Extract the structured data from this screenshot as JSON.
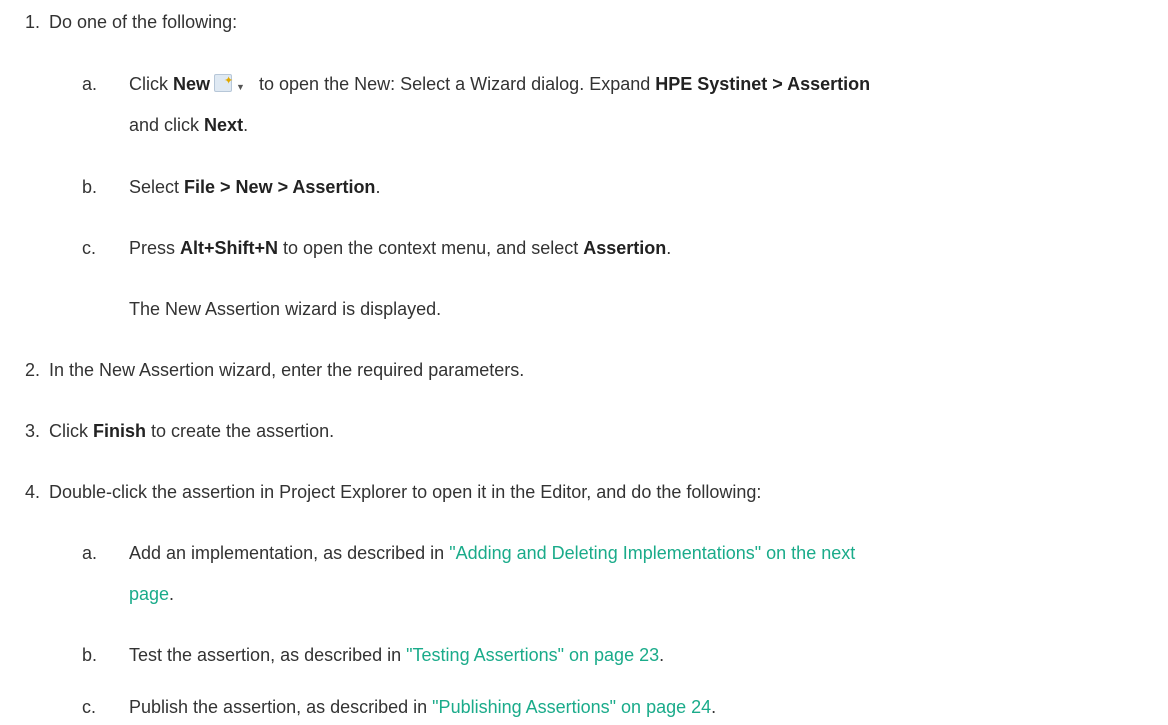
{
  "steps": [
    {
      "num": "1.",
      "text": "Do one of the following:"
    },
    {
      "num": "2.",
      "text": "In the New Assertion wizard, enter the required parameters."
    },
    {
      "num": "3.",
      "pre": "Click ",
      "bold": "Finish",
      "post": " to create the assertion."
    },
    {
      "num": "4.",
      "text": "Double-click the assertion in Project Explorer to open it in the Editor, and do the following:"
    }
  ],
  "step1": {
    "a": {
      "letter": "a.",
      "t1": "Click ",
      "b1": "New",
      "t2": " to open the New: Select a Wizard dialog. Expand ",
      "b2": "HPE Systinet > Assertion",
      "t3": "and click ",
      "b3": "Next",
      "t4": "."
    },
    "b": {
      "letter": "b.",
      "t1": "Select ",
      "b1": "File > New > Assertion",
      "t2": "."
    },
    "c": {
      "letter": "c.",
      "t1": "Press ",
      "b1": "Alt+Shift+N",
      "t2": " to open the context menu, and select ",
      "b2": "Assertion",
      "t3": "."
    },
    "result": "The New Assertion wizard is displayed."
  },
  "step4": {
    "a": {
      "letter": "a.",
      "t1": "Add an implementation, as described in ",
      "link1": "\"Adding and Deleting Implementations\" on the next",
      "link2": "page",
      "t2": "."
    },
    "b": {
      "letter": "b.",
      "t1": "Test the assertion, as described in ",
      "link": "\"Testing Assertions\" on page 23",
      "t2": "."
    },
    "c": {
      "letter": "c.",
      "t1": "Publish the assertion, as described in ",
      "link": "\"Publishing Assertions\" on page 24",
      "t2": "."
    }
  },
  "icons": {
    "new": "new-wizard-dropdown-icon"
  },
  "colors": {
    "text": "#333333",
    "link": "#1aab8a"
  }
}
